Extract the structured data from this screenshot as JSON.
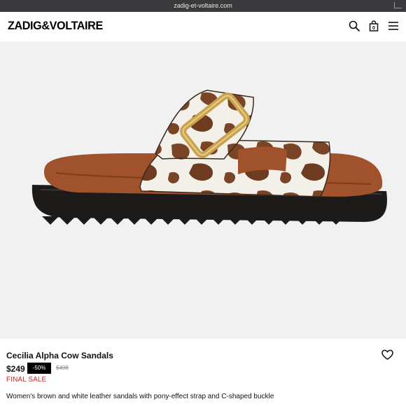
{
  "browser": {
    "url": "zadig-et-voltaire.com"
  },
  "header": {
    "logo": "ZADIG&VOLTAIRE",
    "icons": [
      "search-icon",
      "shopping-bag-icon",
      "menu-icon"
    ],
    "bag_count": "0"
  },
  "product": {
    "name": "Cecilia Alpha Cow Sandals",
    "price": "$249",
    "discount": "-50%",
    "original_price": "$498",
    "final_sale": "FINAL SALE",
    "description": "Women's brown and white leather sandals with pony-effect strap and C-shaped buckle"
  },
  "colors": {
    "image_background": "#f1f1f1",
    "sole": "#1c1b1a",
    "footbed": "#a0522d",
    "cow_brown": "#7a4426",
    "buckle_gold": "#c9a24e",
    "final_sale_red": "#c0282c"
  }
}
